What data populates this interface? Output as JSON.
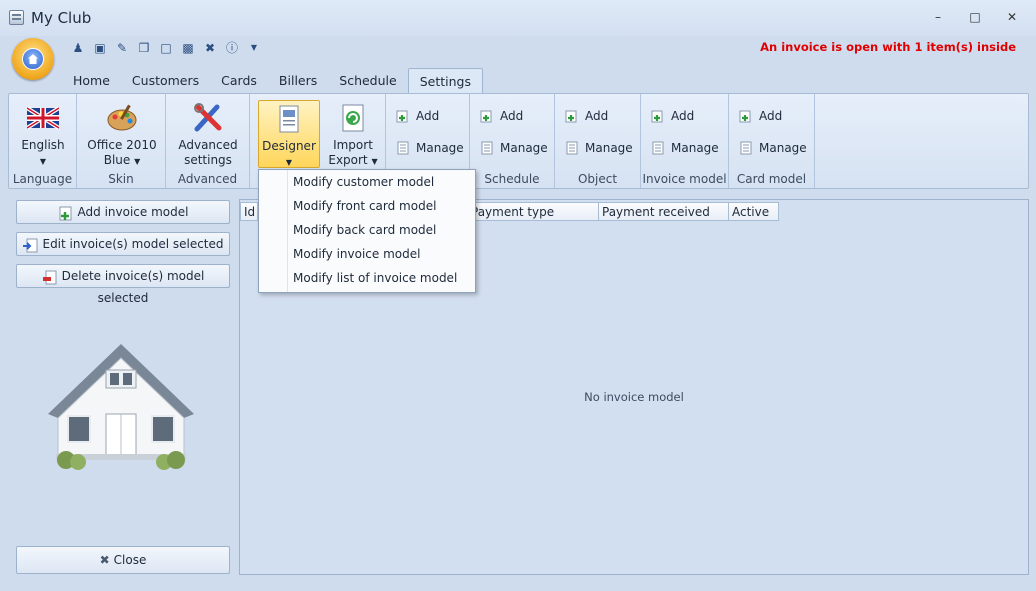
{
  "window": {
    "title": "My Club",
    "status_message": "An invoice is open with 1 item(s) inside",
    "controls": [
      "minimize-icon",
      "maximize-icon",
      "close-icon"
    ]
  },
  "quick_access": [
    "user-add-icon",
    "card-icon",
    "pen-icon",
    "copy-icon",
    "page-icon",
    "folder-icon",
    "tools-icon",
    "info-icon",
    "customize-caret-icon"
  ],
  "tabs": [
    {
      "label": "Home",
      "active": false
    },
    {
      "label": "Customers",
      "active": false
    },
    {
      "label": "Cards",
      "active": false
    },
    {
      "label": "Billers",
      "active": false
    },
    {
      "label": "Schedule",
      "active": false
    },
    {
      "label": "Settings",
      "active": true
    }
  ],
  "ribbon": {
    "language": {
      "button": "English",
      "group": "Language"
    },
    "skin": {
      "button_line1": "Office 2010",
      "button_line2": "Blue",
      "group": "Skin"
    },
    "advanced": {
      "button_line1": "Advanced",
      "button_line2": "settings",
      "group": "Advanced"
    },
    "designer": {
      "button": "Designer"
    },
    "import_export": {
      "button_line1": "Import",
      "button_line2": "Export"
    },
    "add_label": "Add",
    "manage_label": "Manage",
    "groups": {
      "schedule": "Schedule",
      "object": "Object",
      "invoice_model": "Invoice model",
      "card_model": "Card model"
    }
  },
  "designer_menu": [
    "Modify customer model",
    "Modify front card model",
    "Modify back card model",
    "Modify invoice model",
    "Modify list of invoice model"
  ],
  "left_panel": {
    "add_button": "Add invoice model",
    "edit_button": "Edit invoice(s) model selected",
    "delete_button": "Delete invoice(s) model selected",
    "close_button": "Close"
  },
  "grid": {
    "columns": [
      "Id",
      "",
      "",
      "Payment type",
      "Payment received",
      "Active"
    ],
    "empty_message": "No invoice model"
  },
  "colors": {
    "status_red": "#e00000",
    "ribbon_hot": "#ffd65b",
    "panel_bg": "#cfdcee"
  }
}
